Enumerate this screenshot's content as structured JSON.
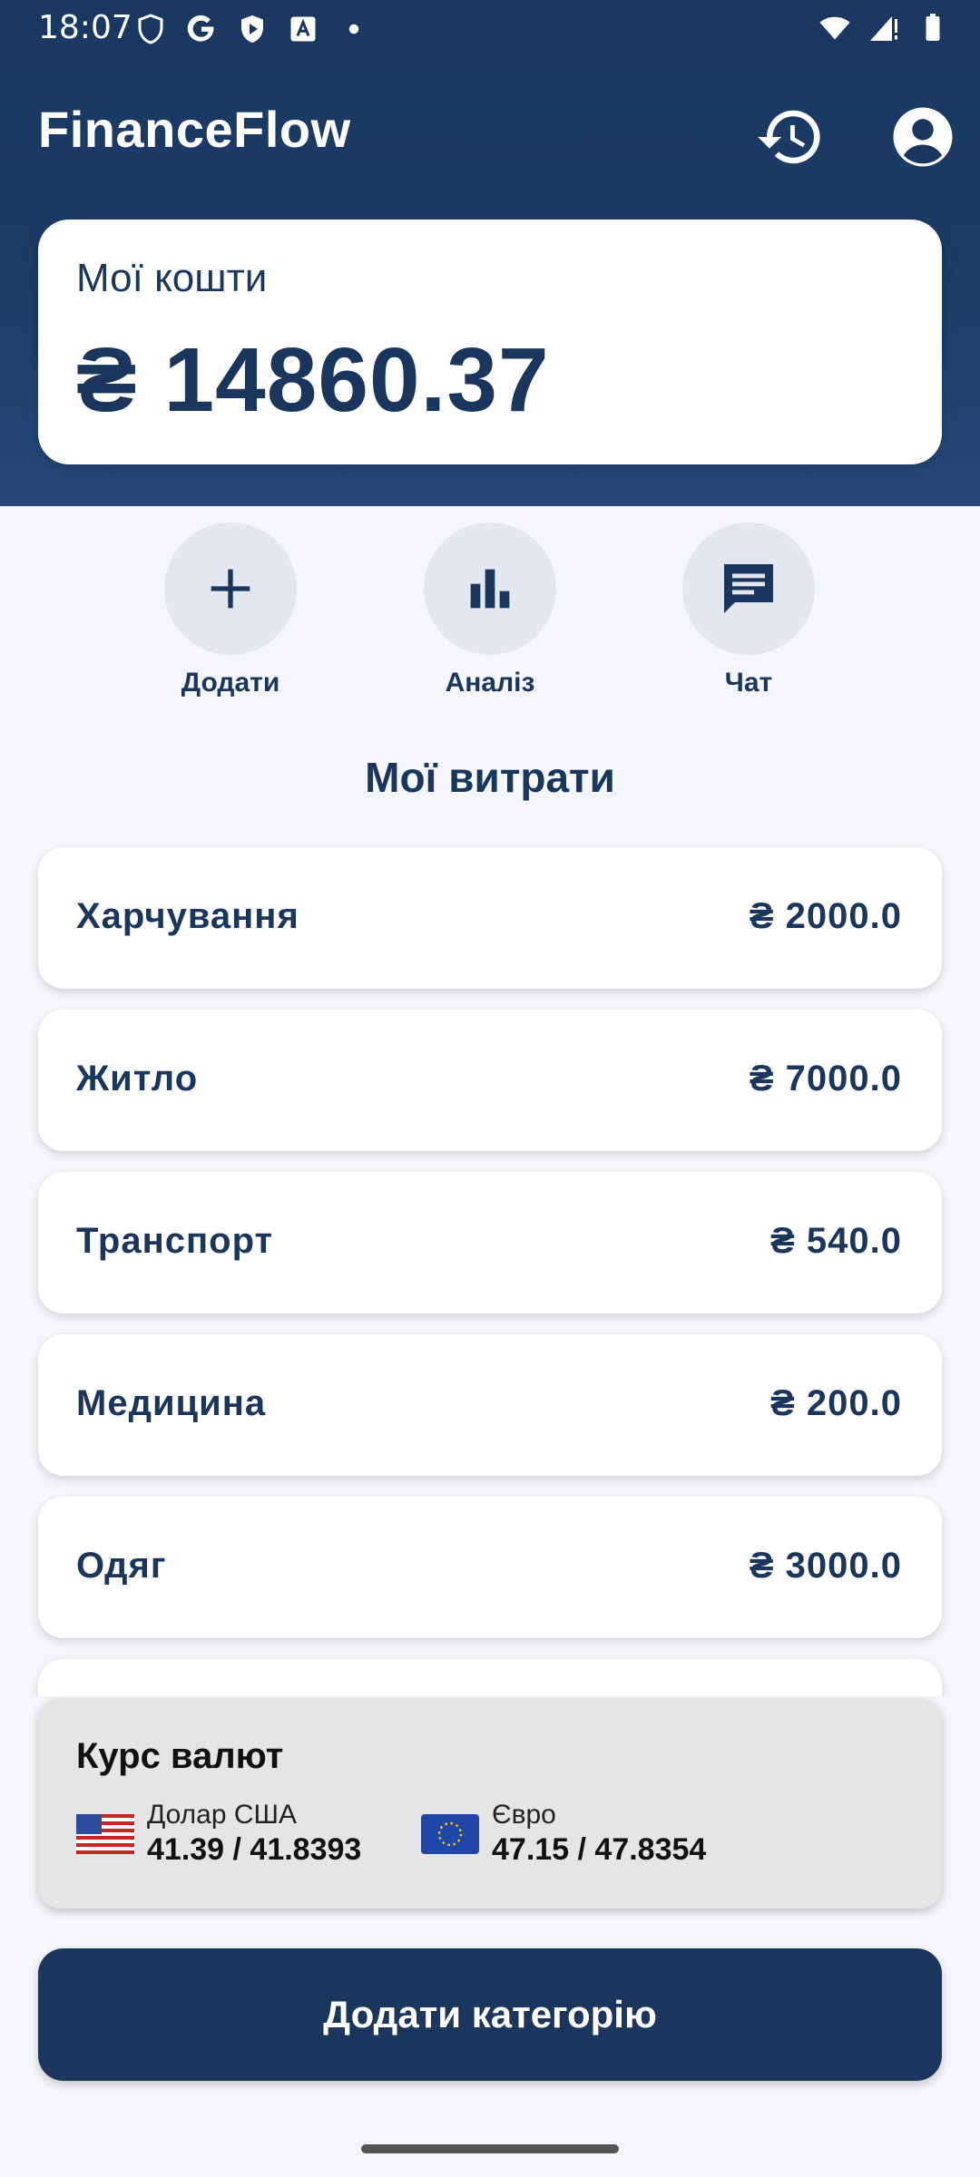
{
  "status_bar": {
    "time": "18:07"
  },
  "app_bar": {
    "title": "FinanceFlow",
    "history_icon": "history-icon",
    "account_icon": "account-circle-icon"
  },
  "balance": {
    "label": "Мої кошти",
    "amount": "₴ 14860.37"
  },
  "actions": [
    {
      "label": "Додати",
      "icon": "plus-icon"
    },
    {
      "label": "Аналіз",
      "icon": "bar-chart-icon"
    },
    {
      "label": "Чат",
      "icon": "chat-icon"
    }
  ],
  "expenses": {
    "title": "Мої витрати",
    "items": [
      {
        "name": "Харчування",
        "amount": "₴ 2000.0"
      },
      {
        "name": "Житло",
        "amount": "₴ 7000.0"
      },
      {
        "name": "Транспорт",
        "amount": "₴ 540.0"
      },
      {
        "name": "Медицина",
        "amount": "₴ 200.0"
      },
      {
        "name": "Одяг",
        "amount": "₴ 3000.0"
      }
    ]
  },
  "currency": {
    "title": "Курс валют",
    "rates": [
      {
        "name": "Долар США",
        "value": "41.39 / 41.8393",
        "flag": "us-flag-icon"
      },
      {
        "name": "Євро",
        "value": "47.15 / 47.8354",
        "flag": "eu-flag-icon"
      }
    ]
  },
  "add_category_label": "Додати категорію",
  "colors": {
    "primary": "#1b365d",
    "background": "#f4f6f9",
    "action_circle": "#e3e8ef",
    "currency_card": "#e5e5e5"
  }
}
